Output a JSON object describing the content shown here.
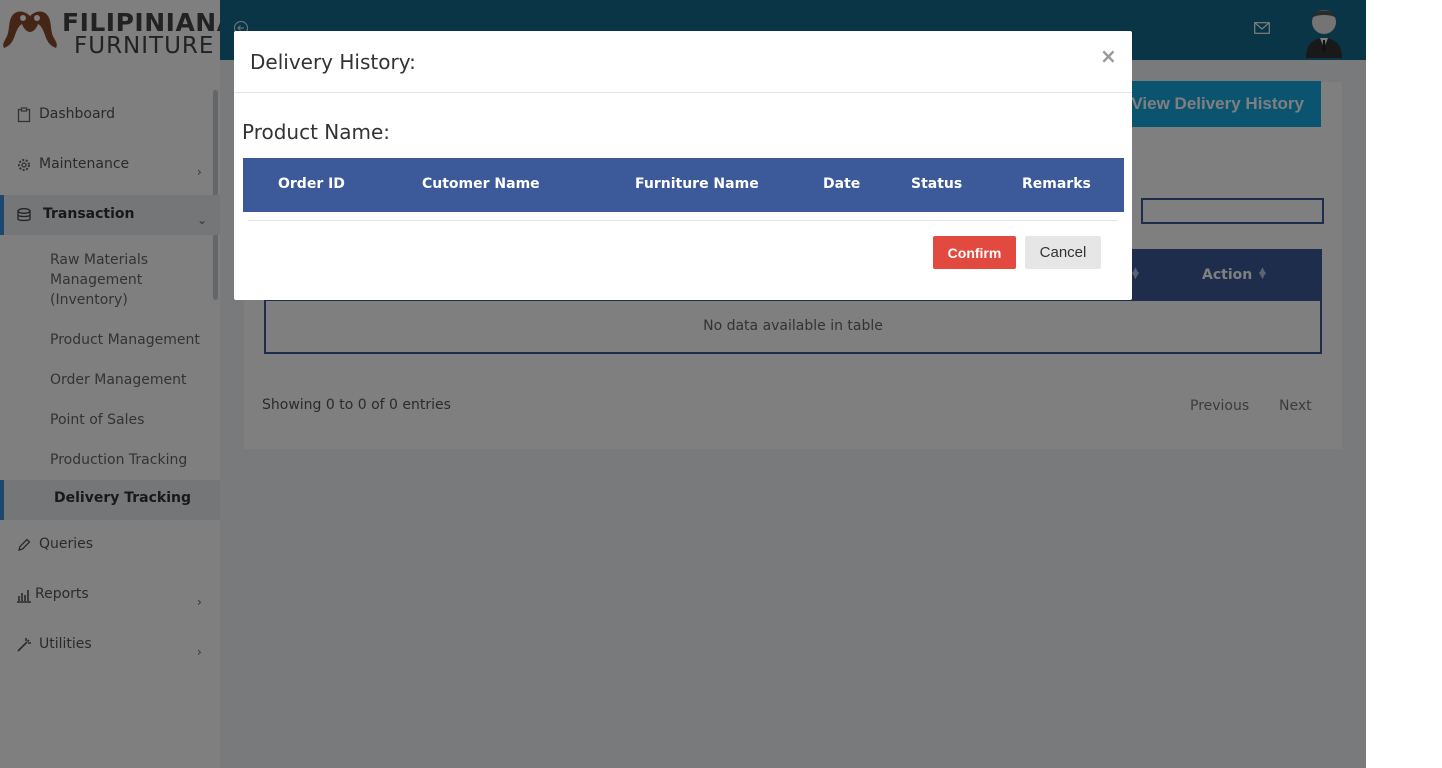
{
  "brand": {
    "line1": "FILIPINIANA",
    "line2": "FURNITURE"
  },
  "sidebar": {
    "items": [
      {
        "label": "Dashboard",
        "icon": "clipboard-icon"
      },
      {
        "label": "Maintenance",
        "icon": "gear-icon"
      },
      {
        "label": "Transaction",
        "icon": "database-icon"
      },
      {
        "label": "Queries",
        "icon": "pencil-icon"
      },
      {
        "label": "Reports",
        "icon": "bar-chart-icon"
      },
      {
        "label": "Utilities",
        "icon": "magic-wand-icon"
      }
    ],
    "transaction_sub": [
      "Raw Materials Management (Inventory)",
      "Product Management",
      "Order Management",
      "Point of Sales",
      "Production Tracking",
      "Delivery Tracking"
    ],
    "raw_materials_lines": [
      "Raw Materials",
      "Management",
      "(Inventory)"
    ]
  },
  "main": {
    "view_history_label": "View Delivery History",
    "table": {
      "action_header": "Action",
      "empty_text": "No data available in table"
    },
    "entries_info": "Showing 0 to 0 of 0 entries",
    "pagination": {
      "previous": "Previous",
      "next": "Next"
    }
  },
  "modal": {
    "title": "Delivery History:",
    "close": "×",
    "product_label": "Product Name:",
    "columns": [
      "Order ID",
      "Cutomer Name",
      "Furniture Name",
      "Date",
      "Status",
      "Remarks"
    ],
    "confirm_label": "Confirm",
    "cancel_label": "Cancel"
  },
  "colors": {
    "header": "#136a8d",
    "table_header": "#3c5a99",
    "accent_button": "#17a9e1",
    "confirm": "#e24a3f",
    "active_marker": "#3b8fd8"
  }
}
